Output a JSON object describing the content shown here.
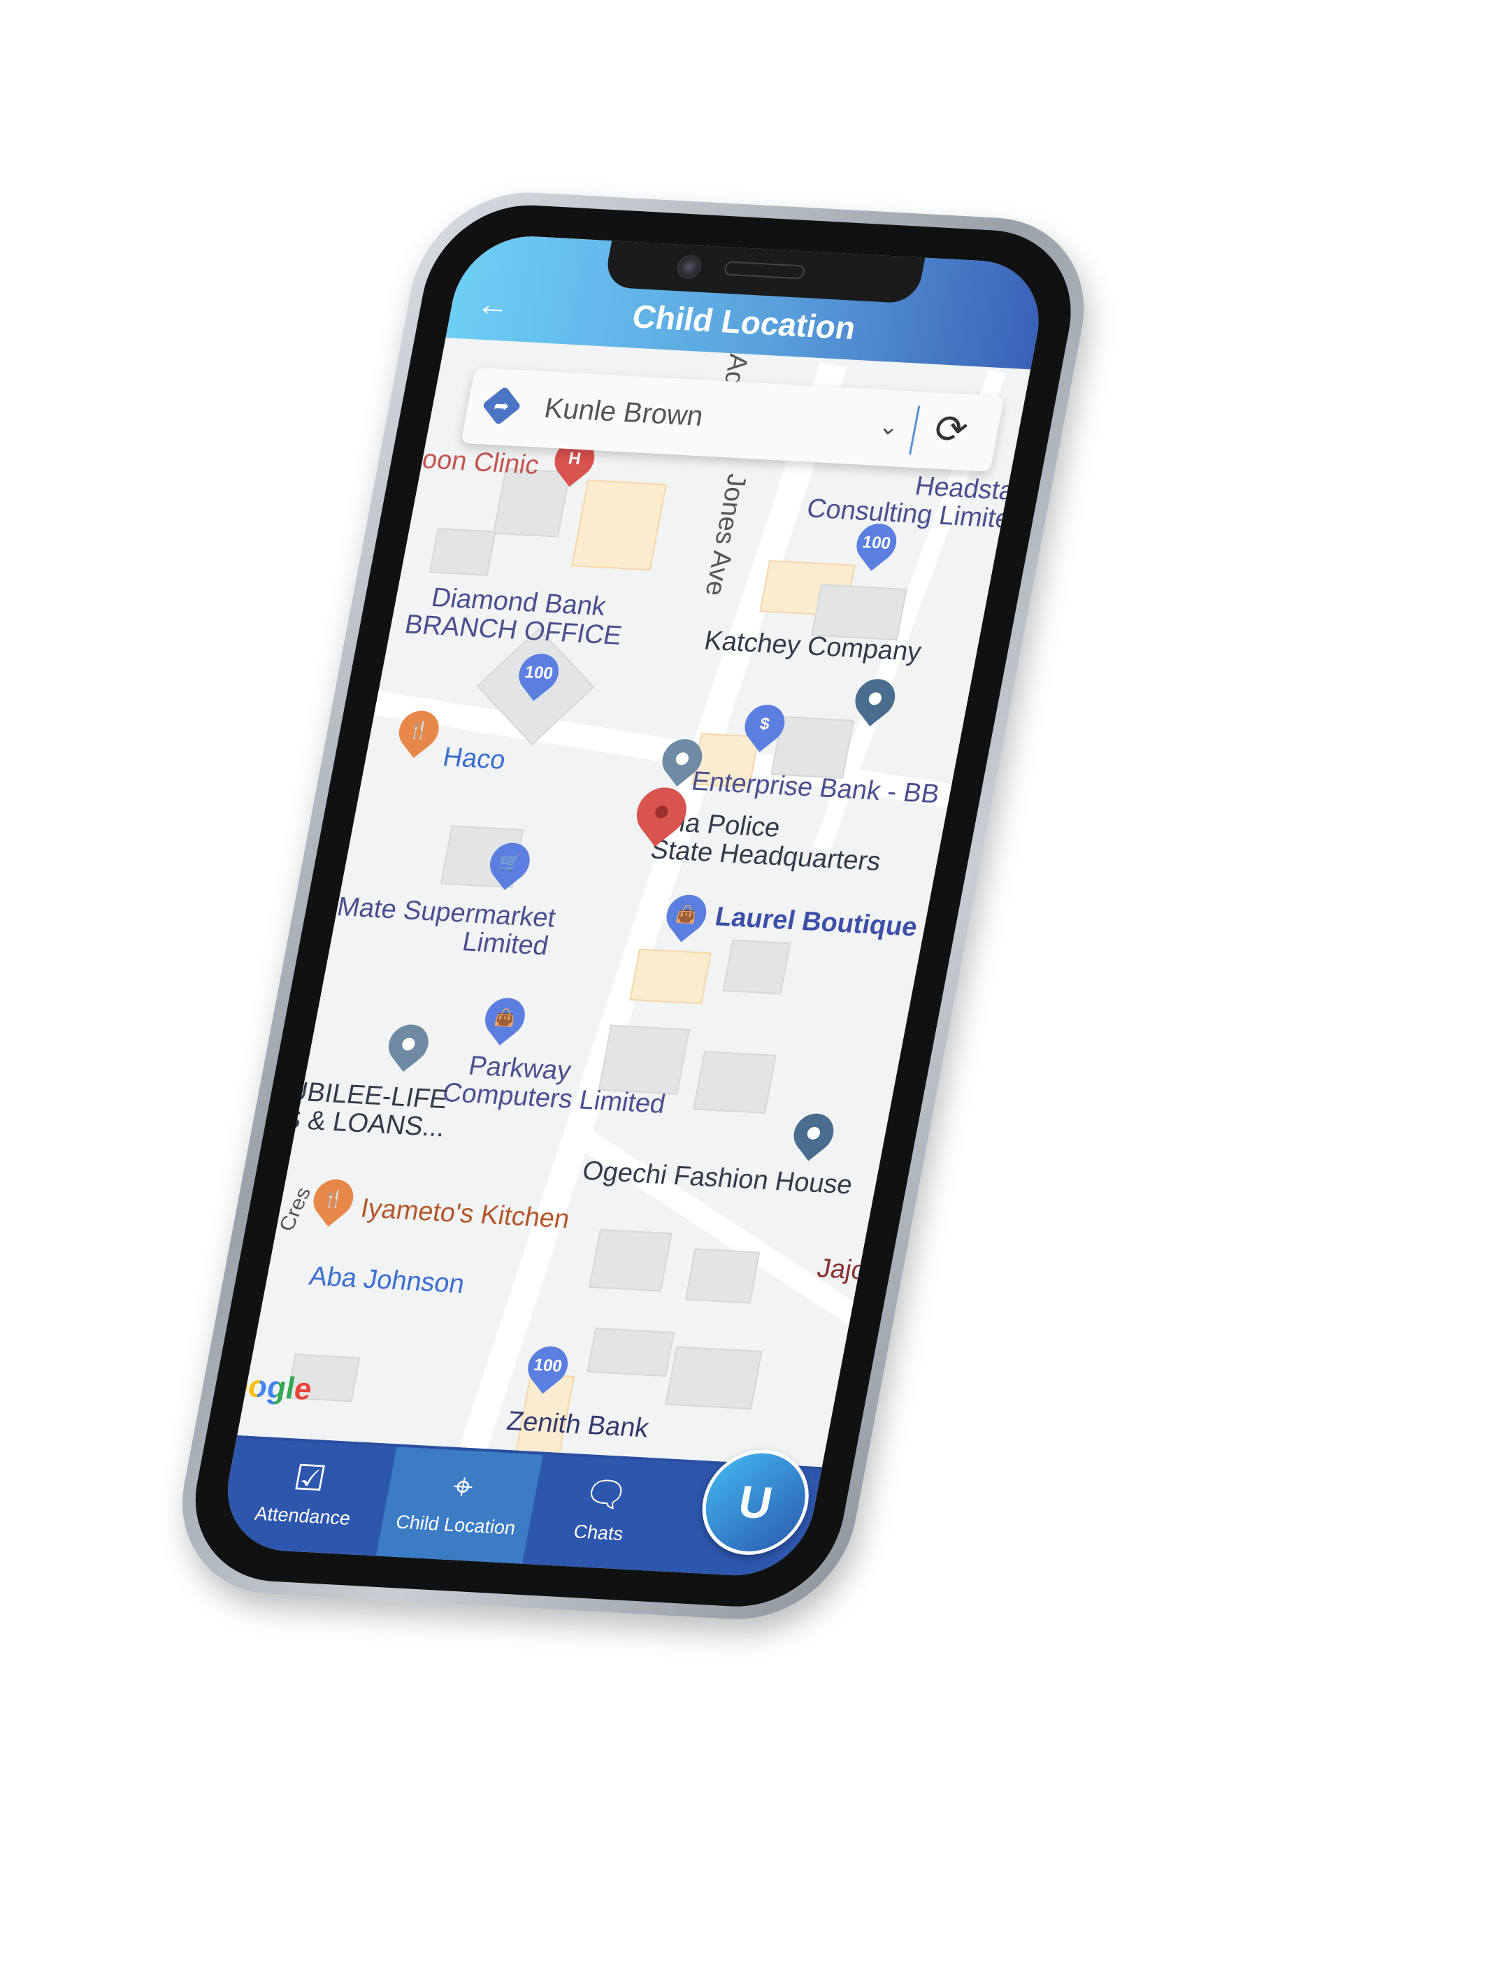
{
  "header": {
    "title": "Child Location",
    "back_icon": "arrow-left-icon"
  },
  "child_selector": {
    "selected": "Kunle Brown",
    "icon": "directions-diamond-icon",
    "chevron": "chevron-down-icon",
    "refresh_icon": "refresh-icon"
  },
  "map": {
    "labels": {
      "clinic": "oon Clinic",
      "ave": "Jones Ave",
      "ad": "Ad",
      "headstart1": "Headstart",
      "headstart2": "Consulting Limited",
      "diamond1": "Diamond Bank",
      "diamond2": "BRANCH OFFICE",
      "katchey": "Katchey Company",
      "haco": "Haco",
      "enterprise": "Enterprise Bank - BB",
      "police1": "eria Police",
      "police2": "State Headquarters",
      "laurel": "Laurel Boutique",
      "mate1": "Mate Supermarket",
      "mate2": "Limited",
      "parkway1": "Parkway",
      "parkway2": "Computers Limited",
      "jubilee1": "UBILEE-LIFE",
      "jubilee2": "S & LOANS...",
      "ogechi": "Ogechi Fashion House",
      "iyameto": "Iyameto's Kitchen",
      "jajo": "Jajo",
      "aba": "Aba Johnson",
      "zenith": "Zenith Bank",
      "cres": "Cres",
      "google": "Google"
    },
    "child_marker_color": "#d9534f"
  },
  "bottom_nav": {
    "items": [
      {
        "label": "Attendance",
        "icon": "calendar-check-icon"
      },
      {
        "label": "Child Location",
        "icon": "crosshair-location-icon",
        "active": true
      },
      {
        "label": "Chats",
        "icon": "chat-bubbles-icon"
      }
    ],
    "fab_icon": "app-logo-u-icon"
  },
  "colors": {
    "header_start": "#6dcff6",
    "header_end": "#3a62b7",
    "nav": "#2d56ad",
    "nav_active": "#3c7cc4"
  }
}
